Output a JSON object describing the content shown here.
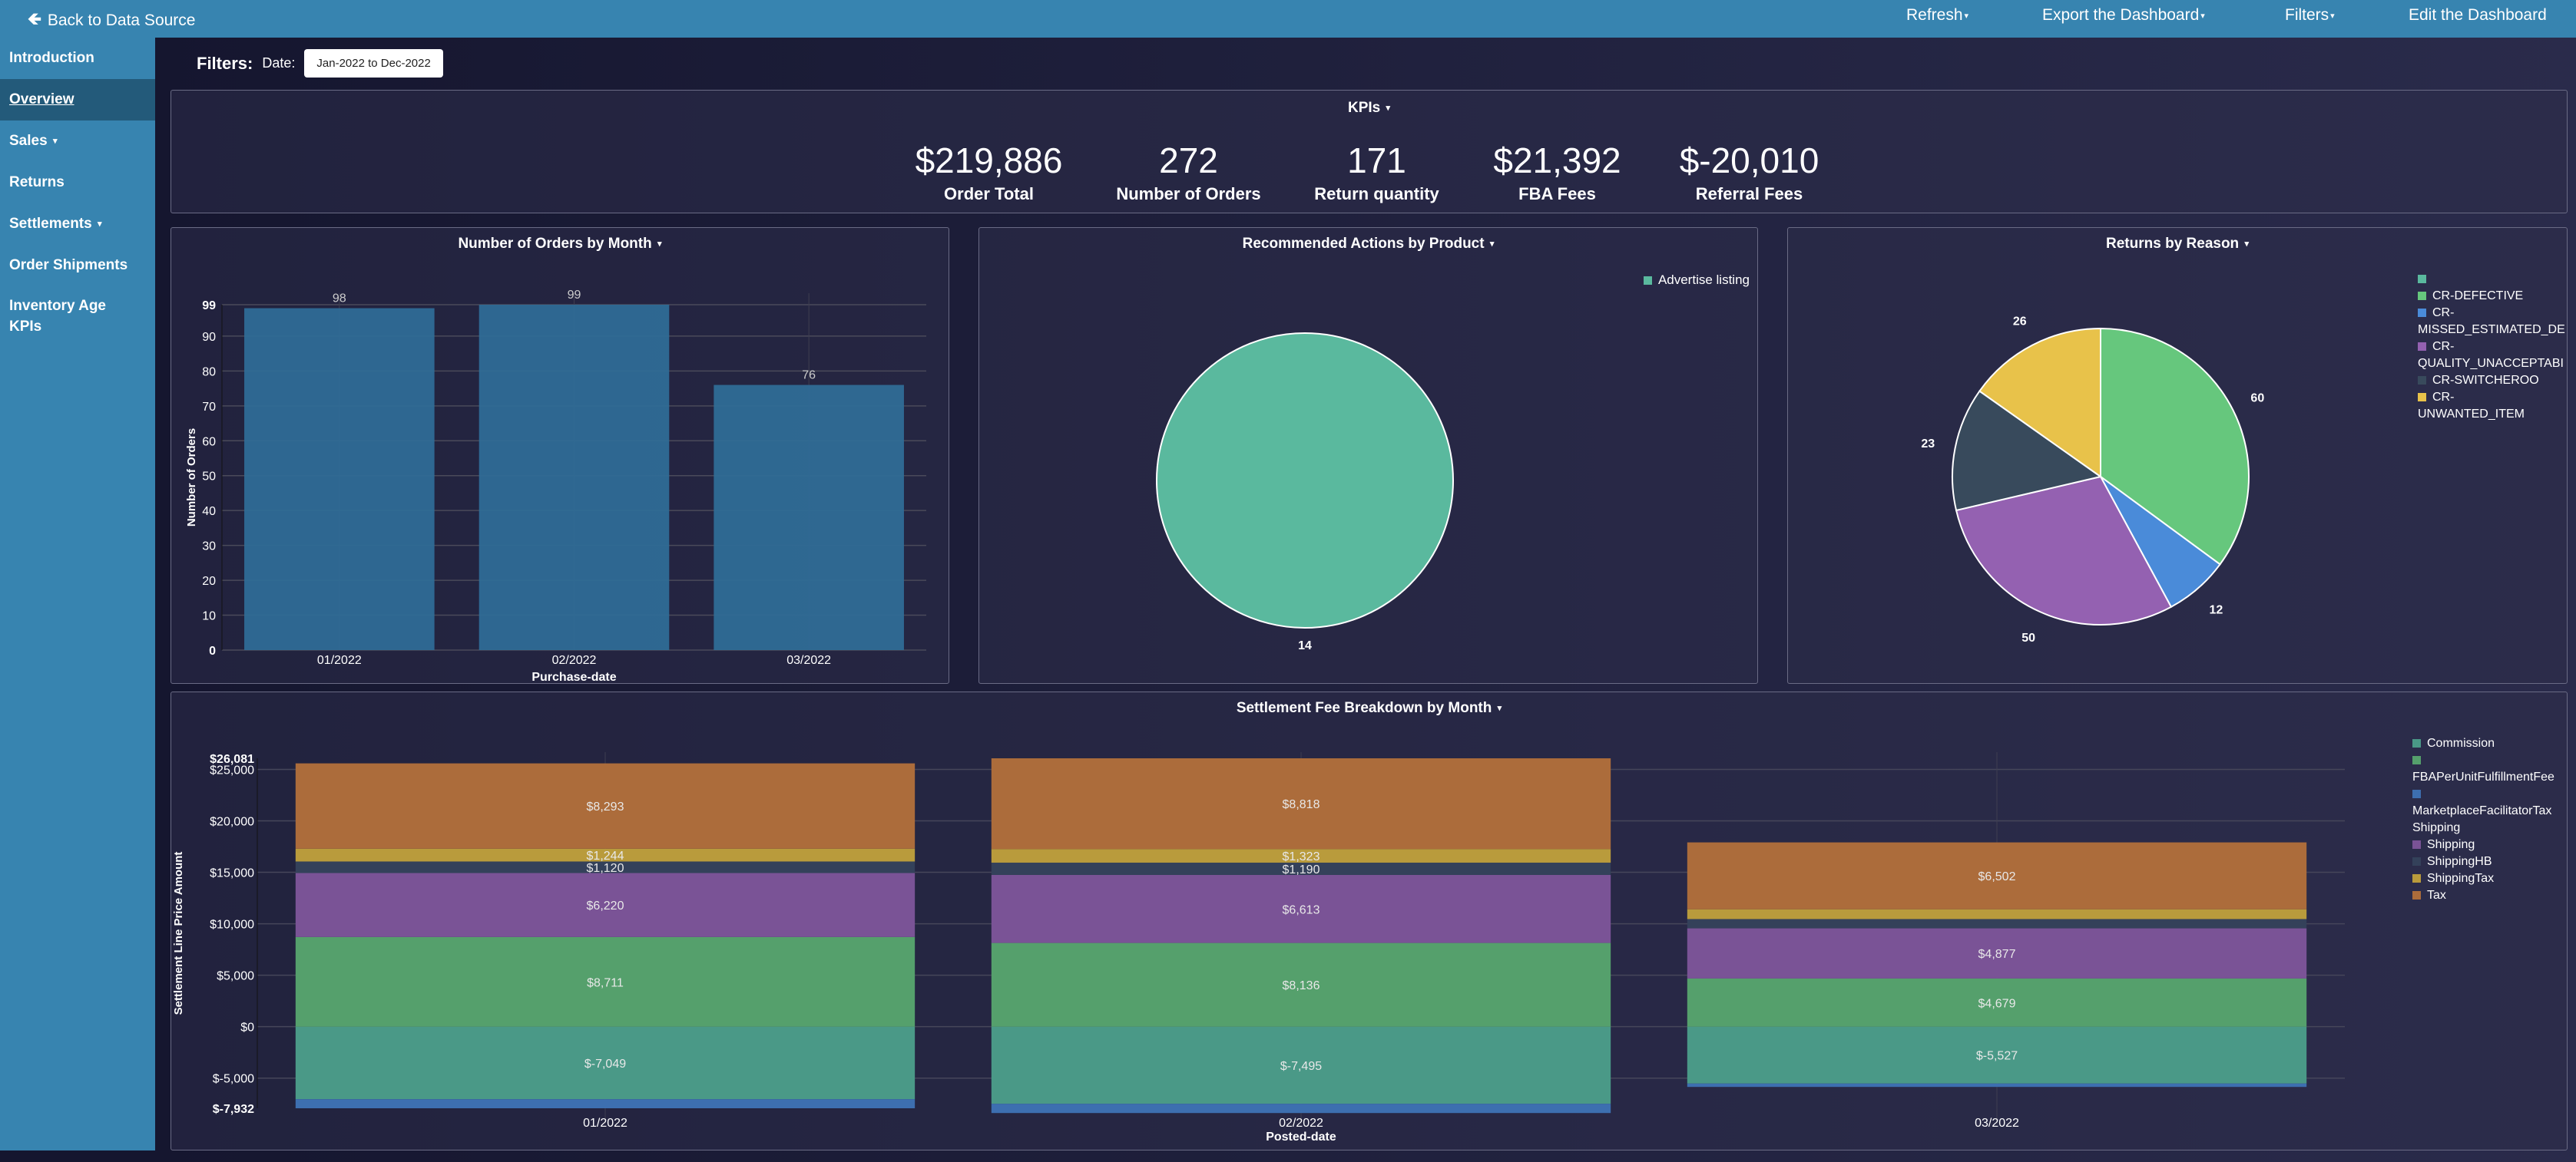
{
  "topbar": {
    "back_label": "Back to Data Source",
    "menus": [
      {
        "label": "Refresh",
        "has_caret": true
      },
      {
        "label": "Export the Dashboard",
        "has_caret": true
      },
      {
        "label": "Filters",
        "has_caret": true
      },
      {
        "label": "Edit the Dashboard",
        "has_caret": false
      }
    ]
  },
  "sidebar": {
    "items": [
      {
        "label": "Introduction",
        "active": false,
        "dropdown": false
      },
      {
        "label": "Overview",
        "active": true,
        "dropdown": false
      },
      {
        "label": "Sales",
        "active": false,
        "dropdown": true
      },
      {
        "label": "Returns",
        "active": false,
        "dropdown": false
      },
      {
        "label": "Settlements",
        "active": false,
        "dropdown": true
      },
      {
        "label": "Order Shipments",
        "active": false,
        "dropdown": false
      },
      {
        "label": "Inventory Age KPIs",
        "active": false,
        "dropdown": false
      }
    ]
  },
  "filters": {
    "label": "Filters:",
    "date_label": "Date:",
    "date_value": "Jan-2022 to Dec-2022"
  },
  "kpis": {
    "title": "KPIs",
    "items": [
      {
        "value": "$219,886",
        "label": "Order Total"
      },
      {
        "value": "272",
        "label": "Number of Orders"
      },
      {
        "value": "171",
        "label": "Return quantity"
      },
      {
        "value": "$21,392",
        "label": "FBA Fees"
      },
      {
        "value": "$-20,010",
        "label": "Referral Fees"
      }
    ]
  },
  "chart_data": [
    {
      "id": "orders",
      "type": "bar",
      "title": "Number of Orders by Month",
      "xlabel": "Purchase-date",
      "ylabel": "Number of Orders",
      "categories": [
        "01/2022",
        "02/2022",
        "03/2022"
      ],
      "values": [
        98,
        99,
        76
      ],
      "yticks": [
        0,
        10,
        20,
        30,
        40,
        50,
        60,
        70,
        80,
        90,
        99
      ],
      "ylim": [
        0,
        99
      ],
      "color": "#2f6b96",
      "grid": true
    },
    {
      "id": "actions",
      "type": "pie",
      "title": "Recommended Actions by Product",
      "labels": [
        "Advertise listing"
      ],
      "values": [
        14
      ],
      "colors": [
        "#5ab99e"
      ],
      "legend": "top-right"
    },
    {
      "id": "returns",
      "type": "pie",
      "title": "Returns by Reason",
      "labels": [
        "",
        "CR-DEFECTIVE",
        "CR-MISSED_ESTIMATED_DE",
        "CR-QUALITY_UNACCEPTABL",
        "CR-SWITCHEROO",
        "CR-UNWANTED_ITEM"
      ],
      "legend_labels": [
        [
          "",
          ""
        ],
        [
          "CR-DEFECTIVE"
        ],
        [
          "CR-",
          "MISSED_ESTIMATED_DE"
        ],
        [
          "CR-",
          "QUALITY_UNACCEPTABI"
        ],
        [
          "CR-SWITCHEROO"
        ],
        [
          "CR-",
          "UNWANTED_ITEM"
        ]
      ],
      "values": [
        0,
        60,
        12,
        50,
        23,
        26
      ],
      "colors": [
        "#5ab99e",
        "#66c77d",
        "#4a8bd9",
        "#9461b1",
        "#384a5c",
        "#e8c24a"
      ],
      "legend": "top-right"
    },
    {
      "id": "settlement",
      "type": "bar",
      "stacked": true,
      "title": "Settlement Fee Breakdown by Month",
      "xlabel": "Posted-date",
      "ylabel": "Settlement Line Price Amount",
      "categories": [
        "01/2022",
        "02/2022",
        "03/2022"
      ],
      "series": [
        {
          "name": "Commission",
          "color": "#4a9987",
          "values": [
            -7049,
            -7495,
            -5527
          ],
          "labels": [
            "$-7,049",
            "$-7,495",
            "$-5,527"
          ]
        },
        {
          "name": "FBAPerUnitFulfillmentFee",
          "color": "#55a06c",
          "values": [
            8711,
            8136,
            4679
          ],
          "labels": [
            "$8,711",
            "$8,136",
            "$4,679"
          ]
        },
        {
          "name": "MarketplaceFacilitatorTax-Shipping",
          "color": "#3d6fb0",
          "values": [
            -883,
            -900,
            -330
          ],
          "labels": [
            "",
            "",
            ""
          ]
        },
        {
          "name": "Shipping",
          "color": "#7a5396",
          "values": [
            6220,
            6613,
            4877
          ],
          "labels": [
            "$6,220",
            "$6,613",
            "$4,877"
          ]
        },
        {
          "name": "ShippingHB",
          "color": "#34415a",
          "values": [
            1120,
            1190,
            900
          ],
          "labels": [
            "$1,120",
            "$1,190",
            ""
          ]
        },
        {
          "name": "ShippingTax",
          "color": "#b99b3c",
          "values": [
            1244,
            1323,
            950
          ],
          "labels": [
            "$1,244",
            "$1,323",
            ""
          ]
        },
        {
          "name": "Tax",
          "color": "#ac6c3b",
          "values": [
            8293,
            8818,
            6502
          ],
          "labels": [
            "$8,293",
            "$8,818",
            "$6,502"
          ]
        }
      ],
      "legend_labels": [
        [
          "Commission"
        ],
        [
          "",
          "FBAPerUnitFulfillmentFee"
        ],
        [
          "",
          "MarketplaceFacilitatorTax",
          "Shipping"
        ],
        [
          "Shipping"
        ],
        [
          "ShippingHB"
        ],
        [
          "ShippingTax"
        ],
        [
          "Tax"
        ]
      ],
      "ylim": [
        -7932,
        26081
      ],
      "yticks": [
        {
          "v": 26081,
          "label": "$26,081",
          "bold": true
        },
        {
          "v": 25000,
          "label": "$25,000"
        },
        {
          "v": 20000,
          "label": "$20,000"
        },
        {
          "v": 15000,
          "label": "$15,000"
        },
        {
          "v": 10000,
          "label": "$10,000"
        },
        {
          "v": 5000,
          "label": "$5,000"
        },
        {
          "v": 0,
          "label": "$0"
        },
        {
          "v": -5000,
          "label": "$-5,000"
        },
        {
          "v": -7932,
          "label": "$-7,932",
          "bold": true
        }
      ],
      "legend": "top-right",
      "grid": true
    }
  ]
}
